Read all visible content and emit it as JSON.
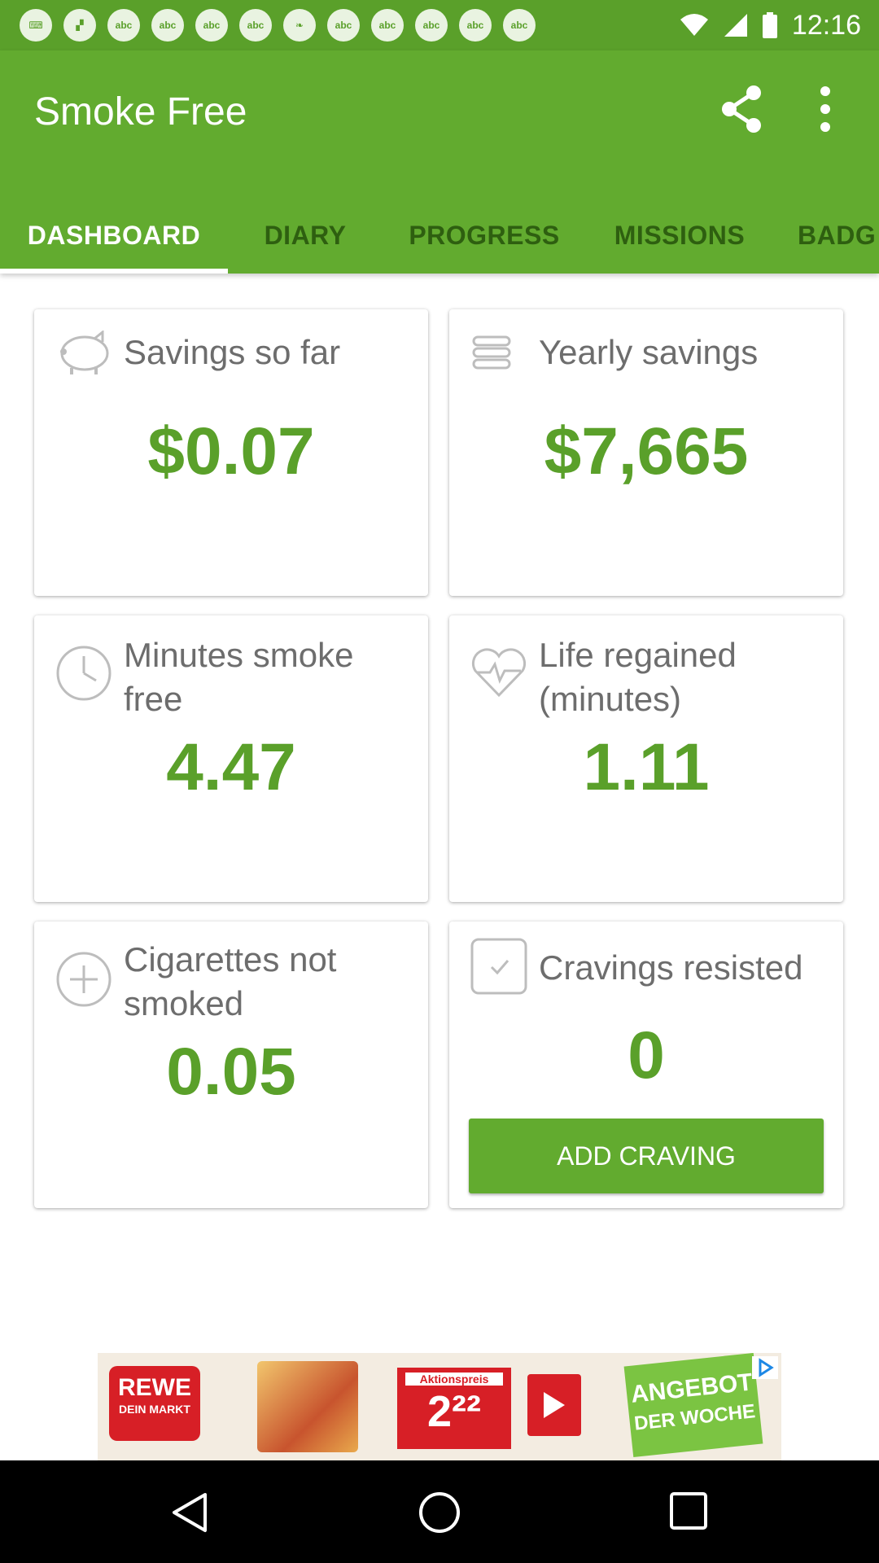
{
  "status_bar": {
    "time": "12:16",
    "notification_icons": [
      "keyboard-icon",
      "flipboard-icon",
      "abc-icon",
      "abc-icon",
      "abc-icon",
      "abc-icon",
      "leaf-icon",
      "abc-icon",
      "abc-icon",
      "abc-icon",
      "abc-icon",
      "abc-icon"
    ],
    "notif_text": [
      "",
      "",
      "abc",
      "abc",
      "abc",
      "",
      "",
      "abc",
      "abc",
      "abc",
      "abc",
      "abc"
    ]
  },
  "app": {
    "title": "Smoke Free"
  },
  "tabs": [
    {
      "label": "DASHBOARD",
      "active": true
    },
    {
      "label": "DIARY"
    },
    {
      "label": "PROGRESS"
    },
    {
      "label": "MISSIONS"
    },
    {
      "label": "BADG"
    }
  ],
  "cards": [
    {
      "icon": "piggy-bank-icon",
      "label": "Savings so far",
      "value": "$0.07"
    },
    {
      "icon": "coins-icon",
      "label": "Yearly savings",
      "value": "$7,665"
    },
    {
      "icon": "clock-icon",
      "label": "Minutes smoke free",
      "value": "4.47"
    },
    {
      "icon": "heart-pulse-icon",
      "label": "Life regained (minutes)",
      "value": "1.11"
    },
    {
      "icon": "plus-circle-icon",
      "label": "Cigarettes not smoked",
      "value": "0.05"
    },
    {
      "icon": "checkbox-icon",
      "label": "Cravings resisted",
      "value": "0",
      "button": "ADD CRAVING"
    }
  ],
  "ad": {
    "brand": "REWE",
    "brand_sub": "DEIN MARKT",
    "price_label": "Aktionspreis",
    "price": "2²²",
    "offer_line1": "ANGEBOT",
    "offer_line2": "DER WOCHE"
  },
  "colors": {
    "accent": "#62ab2f",
    "status": "#5aa02a",
    "value_green": "#5aa02a"
  }
}
